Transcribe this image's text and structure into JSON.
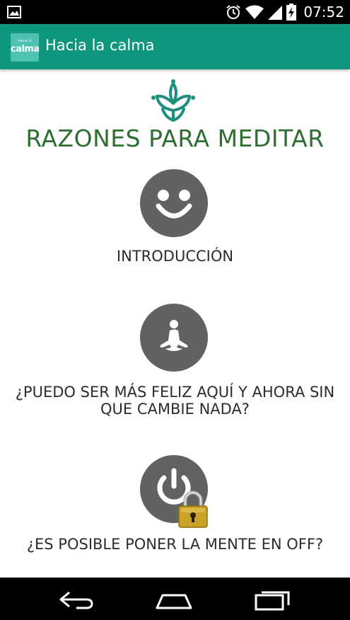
{
  "status_bar": {
    "time": "07:52",
    "icons": [
      "image-notification-icon",
      "alarm-clock-icon",
      "wifi-icon",
      "signal-icon",
      "battery-charging-icon"
    ]
  },
  "app_bar": {
    "logo_small_text": "hacia la",
    "logo_text": "calma",
    "title": "Hacia la calma",
    "color": "#0f977d"
  },
  "content": {
    "title": "RAZONES PARA MEDITAR",
    "title_color": "#2e6e31",
    "items": [
      {
        "label": "INTRODUCCIÓN",
        "icon": "smiley-face-icon",
        "locked": false
      },
      {
        "label": "¿PUEDO SER MÁS FELIZ AQUÍ Y AHORA SIN QUE CAMBIE NADA?",
        "icon": "meditating-person-icon",
        "locked": false
      },
      {
        "label": "¿ES POSIBLE PONER LA MENTE EN OFF?",
        "icon": "power-icon",
        "locked": true
      }
    ]
  },
  "nav_bar": {
    "buttons": [
      "back-button",
      "home-button",
      "recent-apps-button"
    ]
  }
}
